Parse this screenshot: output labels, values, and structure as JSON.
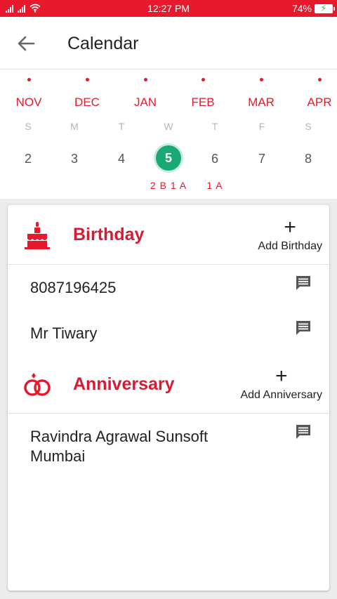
{
  "status_bar": {
    "time": "12:27 PM",
    "battery": "74%"
  },
  "app_bar": {
    "title": "Calendar"
  },
  "calendar": {
    "months": [
      "NOV",
      "DEC",
      "JAN",
      "FEB",
      "MAR",
      "APR"
    ],
    "weekdays": [
      "S",
      "M",
      "T",
      "W",
      "T",
      "F",
      "S"
    ],
    "days": [
      "2",
      "3",
      "4",
      "5",
      "6",
      "7",
      "8"
    ],
    "selected_day": "5",
    "day_counts": [
      "",
      "",
      "",
      "2 B 1 A",
      "1 A",
      "",
      ""
    ]
  },
  "birthday": {
    "title": "Birthday",
    "add_plus": "+",
    "add_label": "Add Birthday",
    "entries": [
      "8087196425",
      "Mr Tiwary"
    ]
  },
  "anniversary": {
    "title": "Anniversary",
    "add_plus": "+",
    "add_label": "Add Anniversary",
    "entries": [
      "Ravindra Agrawal Sunsoft\nMumbai"
    ]
  },
  "colors": {
    "accent": "#e8192c",
    "title_red": "#d81b35",
    "selected_green": "#19a974"
  },
  "icons": {
    "back": "arrow-left",
    "birthday": "cake",
    "anniversary": "rings",
    "entry_action": "message-bubble"
  }
}
